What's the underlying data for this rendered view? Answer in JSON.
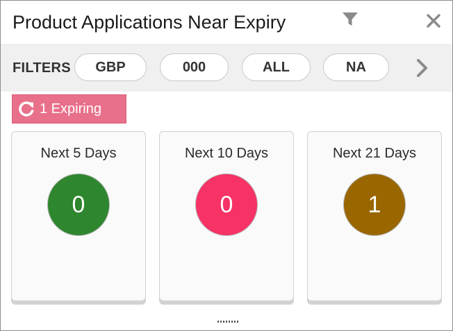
{
  "header": {
    "title": "Product Applications Near Expiry"
  },
  "filters": {
    "label": "FILTERS",
    "chips": [
      "GBP",
      "000",
      "ALL",
      "NA"
    ]
  },
  "expiring": {
    "label": "1 Expiring",
    "color": "#e8708a"
  },
  "cards": [
    {
      "label": "Next 5 Days",
      "count": "0",
      "color": "#2e862e"
    },
    {
      "label": "Next 10 Days",
      "count": "0",
      "color": "#f63266"
    },
    {
      "label": "Next 21 Days",
      "count": "1",
      "color": "#996600"
    }
  ],
  "icons": {
    "filter": "filter-icon",
    "close": "close-icon",
    "next": "chevron-right-icon",
    "refresh": "refresh-icon",
    "resize": "resize-handle-icon"
  }
}
